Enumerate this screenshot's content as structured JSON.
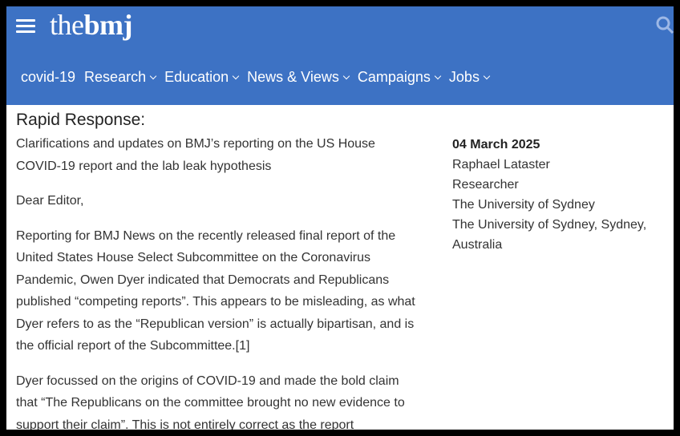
{
  "header": {
    "logo_the": "the",
    "logo_bmj": "bmj",
    "brand_color": "#3d72c4"
  },
  "nav": {
    "items": [
      {
        "label": "covid-19",
        "has_dropdown": false
      },
      {
        "label": "Research",
        "has_dropdown": true
      },
      {
        "label": "Education",
        "has_dropdown": true
      },
      {
        "label": "News & Views",
        "has_dropdown": true
      },
      {
        "label": "Campaigns",
        "has_dropdown": true
      },
      {
        "label": "Jobs",
        "has_dropdown": true
      }
    ]
  },
  "article": {
    "label": "Rapid Response:",
    "title_line1": "Clarifications and updates on BMJ’s reporting on the US House",
    "title_line2": "COVID-19 report and the lab leak hypothesis",
    "greeting": "Dear Editor,",
    "p1": [
      "Reporting for BMJ News on the recently released final report of the",
      "United States House Select Subcommittee on the Coronavirus",
      "Pandemic, Owen Dyer indicated that Democrats and Republicans",
      "published “competing reports”. This appears to be misleading, as what",
      "Dyer refers to as the “Republican version” is actually bipartisan, and is",
      "the official report of the Subcommittee.[1]"
    ],
    "p2": [
      "Dyer focussed on the origins of COVID-19 and made the bold claim",
      "that “The Republicans on the committee brought no new evidence to",
      "support their claim”. This is not entirely correct as the report"
    ]
  },
  "author": {
    "date": "04 March 2025",
    "name": "Raphael Lataster",
    "role": "Researcher",
    "institution": "The University of Sydney",
    "address_line1": "The University of Sydney, Sydney,",
    "address_line2": "Australia"
  },
  "icons": {
    "menu": "hamburger-menu-icon",
    "search": "search-icon",
    "dropdown": "chevron-down-icon"
  }
}
